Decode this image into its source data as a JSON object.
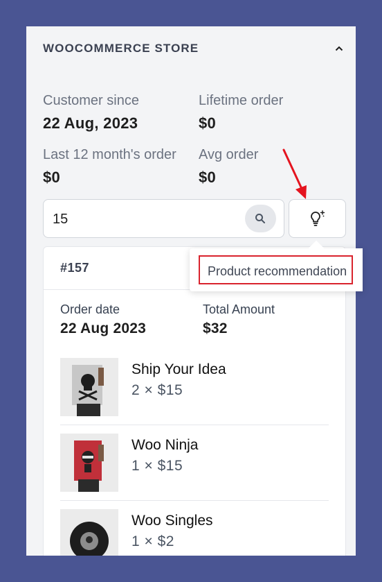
{
  "header": {
    "title": "WOOCOMMERCE STORE",
    "collapse_icon": "chevron-up-icon"
  },
  "stats": [
    {
      "label": "Customer since",
      "value": "22 Aug, 2023"
    },
    {
      "label": "Lifetime order",
      "value": "$0"
    },
    {
      "label": "Last 12 month's order",
      "value": "$0"
    },
    {
      "label": "Avg order",
      "value": "$0"
    }
  ],
  "search": {
    "value": "15",
    "icon": "search-icon"
  },
  "recommend_button": {
    "icon": "lightbulb-sparkle-icon"
  },
  "tooltip": {
    "text": "Product recommendation"
  },
  "order": {
    "id": "#157",
    "date_label": "Order date",
    "date_value": "22 Aug 2023",
    "total_label": "Total Amount",
    "total_value": "$32",
    "items": [
      {
        "name": "Ship Your Idea",
        "qty": "2 × $15"
      },
      {
        "name": "Woo Ninja",
        "qty": "1 × $15"
      },
      {
        "name": "Woo Singles",
        "qty": "1 × $2"
      }
    ]
  },
  "colors": {
    "background": "#4a5593",
    "panel": "#f3f4f6",
    "annotation": "#d9232d"
  }
}
